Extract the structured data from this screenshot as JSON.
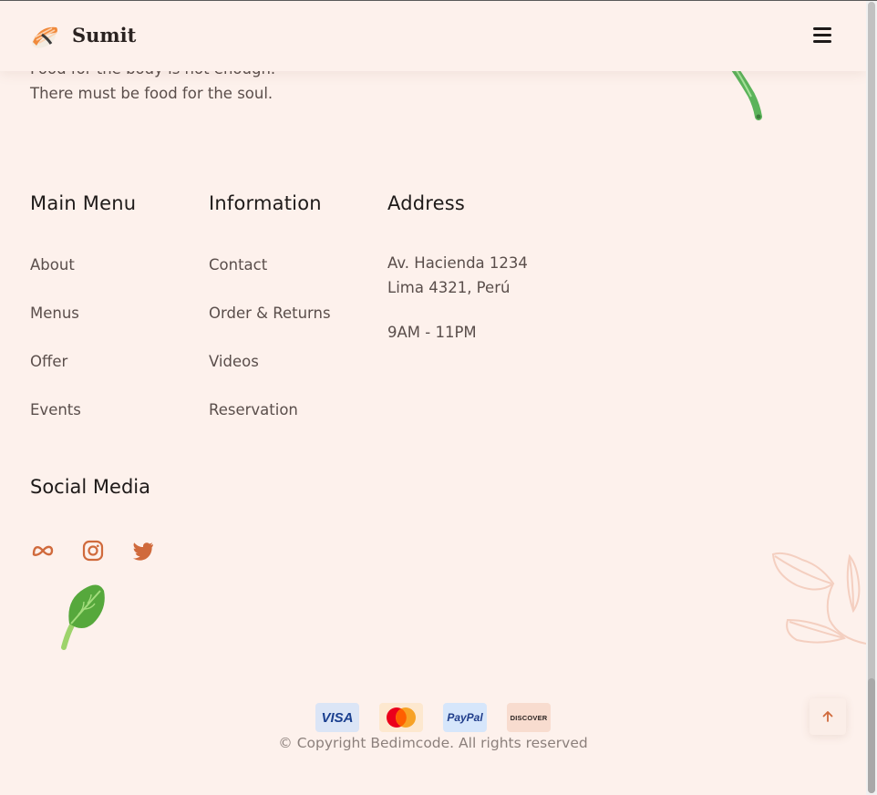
{
  "brand": {
    "name": "Sumit",
    "logo_icon": "sushi-icon"
  },
  "tagline": "Food for the body is not enough. There must be food for the soul.",
  "columns": {
    "main_menu": {
      "title": "Main Menu",
      "items": [
        "About",
        "Menus",
        "Offer",
        "Events"
      ]
    },
    "information": {
      "title": "Information",
      "items": [
        "Contact",
        "Order & Returns",
        "Videos",
        "Reservation"
      ]
    },
    "address": {
      "title": "Address",
      "line1": "Av. Hacienda 1234",
      "line2": "Lima 4321, Perú",
      "hours": "9AM - 11PM"
    }
  },
  "social": {
    "title": "Social Media",
    "icons": [
      "meta-icon",
      "instagram-icon",
      "twitter-icon"
    ]
  },
  "payments": [
    {
      "label": "VISA",
      "icon": "visa-icon"
    },
    {
      "label": "",
      "icon": "mastercard-icon"
    },
    {
      "label": "PayPal",
      "icon": "paypal-icon"
    },
    {
      "label": "DISCOVER",
      "icon": "discover-icon"
    }
  ],
  "copyright": "© Copyright Bedimcode. All rights reserved",
  "colors": {
    "background": "#fdf1ec",
    "accent": "#d06a3c",
    "title": "#1e1a19",
    "text": "#5a4e4b"
  }
}
